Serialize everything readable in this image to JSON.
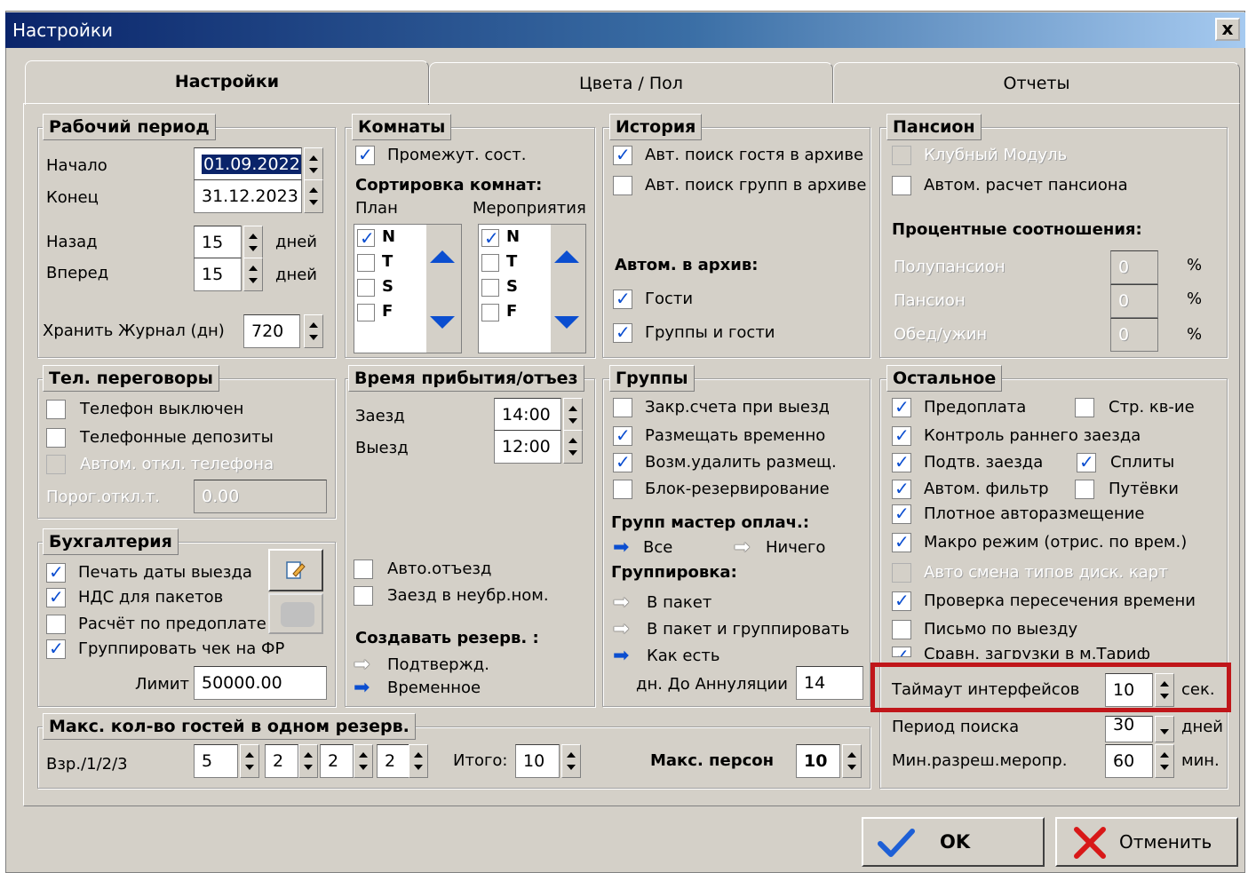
{
  "window": {
    "title": "Настройки",
    "close_label": "x"
  },
  "tabs": [
    {
      "label": "Настройки",
      "active": true
    },
    {
      "label": "Цвета / Пол",
      "active": false
    },
    {
      "label": "Отчеты",
      "active": false
    }
  ],
  "work_period": {
    "title": "Рабочий период",
    "start_label": "Начало",
    "start_value": "01.09.2022",
    "end_label": "Конец",
    "end_value": "31.12.2023",
    "back_label": "Назад",
    "back_value": "15",
    "back_unit": "дней",
    "forward_label": "Вперед",
    "forward_value": "15",
    "forward_unit": "дней",
    "journal_label": "Хранить Журнал (дн)",
    "journal_value": "720"
  },
  "rooms": {
    "title": "Комнаты",
    "intermediate_label": "Промежут. сост.",
    "sort_title": "Сортировка комнат:",
    "plan_label": "План",
    "events_label": "Мероприятия",
    "plan_items": [
      {
        "label": "N",
        "checked": true
      },
      {
        "label": "T",
        "checked": false
      },
      {
        "label": "S",
        "checked": false
      },
      {
        "label": "F",
        "checked": false
      }
    ],
    "events_items": [
      {
        "label": "N",
        "checked": true
      },
      {
        "label": "T",
        "checked": false
      },
      {
        "label": "S",
        "checked": false
      },
      {
        "label": "F",
        "checked": false
      }
    ]
  },
  "history": {
    "title": "История",
    "guest_search_label": "Авт. поиск гостя в архиве",
    "group_search_label": "Авт. поиск групп в архиве",
    "auto_archive_title": "Автом. в архив:",
    "guests_label": "Гости",
    "groups_guests_label": "Группы и гости"
  },
  "board": {
    "title": "Пансион",
    "club_label": "Клубный Модуль",
    "auto_calc_label": "Автом. расчет пансиона",
    "ratio_title": "Процентные соотношения:",
    "rows": [
      {
        "label": "Полупансион",
        "value": "0",
        "unit": "%"
      },
      {
        "label": "Пансион",
        "value": "0",
        "unit": "%"
      },
      {
        "label": "Обед/ужин",
        "value": "0",
        "unit": "%"
      }
    ]
  },
  "phone": {
    "title": "Тел. переговоры",
    "phone_off_label": "Телефон выключен",
    "deposits_label": "Телефонные депозиты",
    "auto_off_label": "Автом. откл. телефона",
    "threshold_label": "Порог.откл.т.",
    "threshold_value": "0.00"
  },
  "accounting": {
    "title": "Бухгалтерия",
    "print_dates_label": "Печать даты выезда",
    "vat_label": "НДС для пакетов",
    "prepay_calc_label": "Расчёт по предоплате",
    "group_receipt_label": "Группировать чек на ФР",
    "limit_label": "Лимит",
    "limit_value": "50000.00"
  },
  "arrival": {
    "title": "Время прибытия/отъез",
    "checkin_label": "Заезд",
    "checkin_value": "14:00",
    "checkout_label": "Выезд",
    "checkout_value": "12:00",
    "auto_departure_label": "Авто.отъезд",
    "dirty_room_label": "Заезд в неубр.ном.",
    "create_reserv_title": "Создавать резерв. :",
    "confirmed_label": "Подтвержд.",
    "temporary_label": "Временное"
  },
  "groups": {
    "title": "Группы",
    "close_accounts_label": "Закр.счета при выезд",
    "place_temp_label": "Размещать временно",
    "can_delete_label": "Возм.удалить размещ.",
    "block_label": "Блок-резервирование",
    "master_pay_title": "Групп мастер оплач.:",
    "all_label": "Все",
    "nothing_label": "Ничего",
    "grouping_title": "Группировка:",
    "package_label": "В пакет",
    "package_group_label": "В пакет и группировать",
    "as_is_label": "Как есть",
    "cancel_days_label": "дн. До Аннуляции",
    "cancel_days_value": "14"
  },
  "other": {
    "title": "Остальное",
    "prepayment_label": "Предоплата",
    "str_label": "Стр. кв-ие",
    "early_checkin_label": "Контроль раннего заезда",
    "confirm_label": "Подтв. заезда",
    "splits_label": "Сплиты",
    "auto_filter_label": "Автом. фильтр",
    "vouchers_label": "Путёвки",
    "dense_label": "Плотное авторазмещение",
    "macro_label": "Макро режим (отрис. по врем.)",
    "auto_cards_label": "Авто смена типов диск. карт",
    "time_check_label": "Проверка пересечения времени",
    "departure_letter_label": "Письмо по выезду",
    "compare_label": "Сравн. загрузки в м.Тариф",
    "timeout_label": "Таймаут интерфейсов",
    "timeout_value": "10",
    "timeout_unit": "сек.",
    "search_period_label": "Период поиска",
    "search_period_value": "30",
    "search_period_unit": "дней",
    "min_event_label": "Мин.разреш.меропр.",
    "min_event_value": "60",
    "min_event_unit": "мин."
  },
  "max_guests": {
    "title": "Макс. кол-во гостей в одном резерв.",
    "row_label": "Взр./1/2/3",
    "values": [
      "5",
      "2",
      "2",
      "2"
    ],
    "total_label": "Итого:",
    "total_value": "10",
    "max_persons_label": "Макс. персон",
    "max_persons_value": "10"
  },
  "buttons": {
    "ok_label": "OK",
    "cancel_label": "Отменить"
  },
  "colors": {
    "accent": "#0b4ed0",
    "highlight": "#c0161a"
  }
}
